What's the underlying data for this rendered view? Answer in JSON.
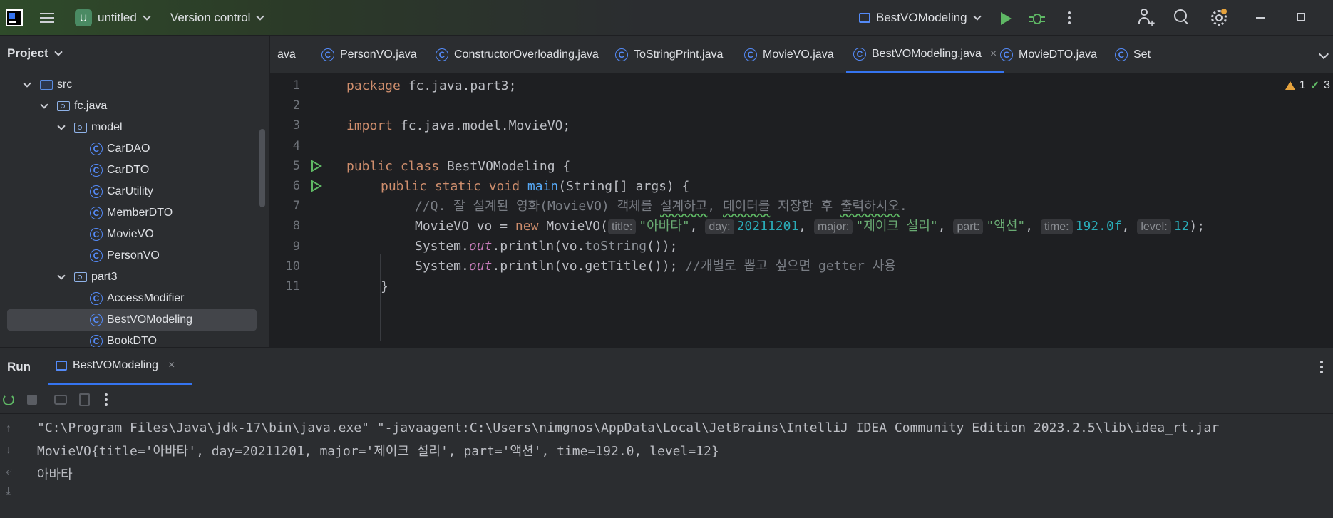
{
  "topbar": {
    "project_badge": "U",
    "project_name": "untitled",
    "version_control": "Version control",
    "run_config": "BestVOModeling"
  },
  "project_panel": {
    "title": "Project",
    "tree": [
      {
        "label": "src",
        "type": "src-folder",
        "depth": 1,
        "expanded": true
      },
      {
        "label": "fc.java",
        "type": "package",
        "depth": 2,
        "expanded": true
      },
      {
        "label": "model",
        "type": "package",
        "depth": 3,
        "expanded": true
      },
      {
        "label": "CarDAO",
        "type": "class",
        "depth": 4
      },
      {
        "label": "CarDTO",
        "type": "class",
        "depth": 4
      },
      {
        "label": "CarUtility",
        "type": "class",
        "depth": 4
      },
      {
        "label": "MemberDTO",
        "type": "class",
        "depth": 4
      },
      {
        "label": "MovieVO",
        "type": "class",
        "depth": 4
      },
      {
        "label": "PersonVO",
        "type": "class",
        "depth": 4
      },
      {
        "label": "part3",
        "type": "package",
        "depth": 3,
        "expanded": true
      },
      {
        "label": "AccessModifier",
        "type": "class",
        "depth": 4
      },
      {
        "label": "BestVOModeling",
        "type": "class",
        "depth": 4,
        "selected": true
      },
      {
        "label": "BookDTO",
        "type": "class",
        "depth": 4
      }
    ]
  },
  "tabs": [
    {
      "label": "ava",
      "icon": false
    },
    {
      "label": "PersonVO.java",
      "icon": true
    },
    {
      "label": "ConstructorOverloading.java",
      "icon": true
    },
    {
      "label": "ToStringPrint.java",
      "icon": true
    },
    {
      "label": "MovieVO.java",
      "icon": true
    },
    {
      "label": "BestVOModeling.java",
      "icon": true,
      "active": true,
      "close": "×"
    },
    {
      "label": "MovieDTO.java",
      "icon": true
    },
    {
      "label": "Set",
      "icon": true
    }
  ],
  "inspections": {
    "warnings": "1",
    "checks": "3"
  },
  "editor": {
    "line_numbers": [
      "1",
      "2",
      "3",
      "4",
      "5",
      "6",
      "7",
      "8",
      "9",
      "10",
      "11"
    ],
    "l1_kw": "package",
    "l1_rest": " fc.java.part3;",
    "l3_kw": "import",
    "l3_rest": " fc.java.model.MovieVO;",
    "l5_kw": "public class",
    "l5_rest": " BestVOModeling {",
    "l6_kw": "public static void",
    "l6_fn": "main",
    "l6_rest": "(String[] args) {",
    "l7_a": "//Q. 잘 설계된 영화(MovieVO) 객체를 ",
    "l7_b": "설계하고",
    "l7_c": ", ",
    "l7_d": "데이터를",
    "l7_e": " 저장한 후 ",
    "l7_f": "출력하시오",
    "l7_g": ".",
    "l8_a": "MovieVO vo = ",
    "l8_new": "new",
    "l8_b": " MovieVO(",
    "l8_h1": "title:",
    "l8_v1": "\"아바타\"",
    "l8_h2": "day:",
    "l8_v2": "20211201",
    "l8_h3": "major:",
    "l8_v3": "\"제이크 설리\"",
    "l8_h4": "part:",
    "l8_v4": "\"액션\"",
    "l8_h5": "time:",
    "l8_v5": "192.0f",
    "l8_h6": "level:",
    "l8_v6": "12",
    "l8_end": ");",
    "l9_a": "System.",
    "l9_out": "out",
    "l9_b": ".println(vo.",
    "l9_m": "toString",
    "l9_c": "());",
    "l10_a": "System.",
    "l10_out": "out",
    "l10_b": ".println(vo.getTitle()); ",
    "l10_cmt": "//개별로 뽑고 싶으면 getter 사용",
    "l11": "}"
  },
  "run": {
    "title": "Run",
    "tab_label": "BestVOModeling",
    "tab_close": "×",
    "console_lines": [
      "\"C:\\Program Files\\Java\\jdk-17\\bin\\java.exe\" \"-javaagent:C:\\Users\\nimgnos\\AppData\\Local\\JetBrains\\IntelliJ IDEA Community Edition 2023.2.5\\lib\\idea_rt.jar",
      "MovieVO{title='아바타', day=20211201, major='제이크 설리', part='액션', time=192.0, level=12}",
      "아바타"
    ]
  },
  "colors": {
    "accent": "#3574f0",
    "run_green": "#5fb865",
    "keyword": "#cf8e6d",
    "string": "#6aab73",
    "number": "#2aacb8"
  }
}
